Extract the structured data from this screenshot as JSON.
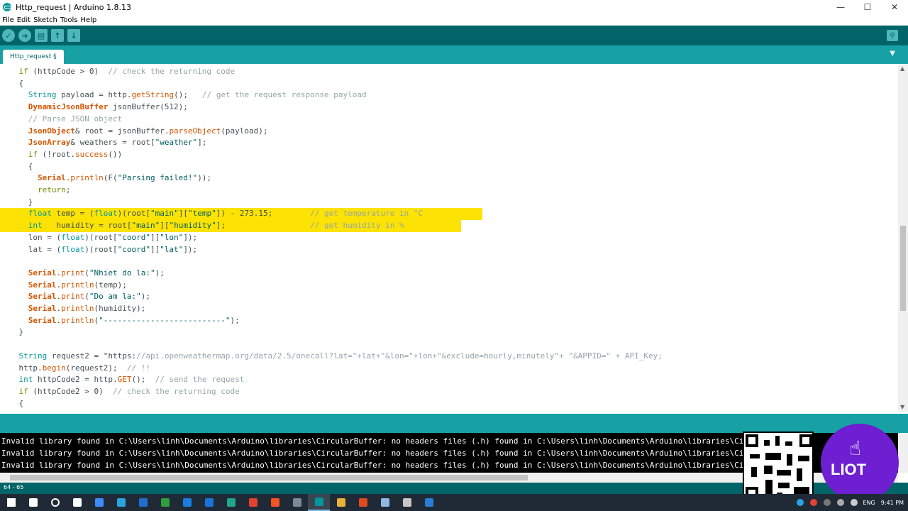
{
  "window": {
    "title": "Http_request | Arduino 1.8.13",
    "minimize": "—",
    "maximize": "☐",
    "close": "✕"
  },
  "menu": [
    "File",
    "Edit",
    "Sketch",
    "Tools",
    "Help"
  ],
  "toolbar": {
    "verify_icon": "check-icon",
    "upload_icon": "arrow-right-icon",
    "new_icon": "file-icon",
    "open_icon": "arrow-up-icon",
    "save_icon": "arrow-down-icon",
    "serial_icon": "magnifier-icon"
  },
  "tab": {
    "label": "Http_request §",
    "menu_icon": "▼"
  },
  "code_lines": [
    "    if (httpCode > 0)  // check the returning code",
    "    {",
    "      String payload = http.getString();   // get the request response payload",
    "      DynamicJsonBuffer jsonBuffer(512);",
    "      // Parse JSON object",
    "      JsonObject& root = jsonBuffer.parseObject(payload);",
    "      JsonArray& weathers = root[\"weather\"];",
    "      if (!root.success())",
    "      {",
    "        Serial.println(F(\"Parsing failed!\"));",
    "        return;",
    "      }",
    "      float temp = (float)(root[\"main\"][\"temp\"]) - 273.15;        // get temperature in °C",
    "      int   humidity = root[\"main\"][\"humidity\"];                  // get humidity in %",
    "      lon = (float)(root[\"coord\"][\"lon\"]);",
    "      lat = (float)(root[\"coord\"][\"lat\"]);",
    "",
    "      Serial.print(\"Nhiet do la:\");",
    "      Serial.println(temp);",
    "      Serial.print(\"Do am la:\");",
    "      Serial.println(humidity);",
    "      Serial.println(\"--------------------------\");",
    "    }",
    "",
    "    String request2 = \"https://api.openweathermap.org/data/2.5/onecall?lat=\"+lat+\"&lon=\"+lon+\"&exclude=hourly,minutely\"+ \"&APPID=\" + API_Key;",
    "    http.begin(request2);  // !!",
    "    int httpCode2 = http.GET();  // send the request",
    "    if (httpCode2 > 0)  // check the returning code",
    "    {"
  ],
  "console_lines": [
    "Invalid library found in C:\\Users\\linh\\Documents\\Arduino\\libraries\\CircularBuffer: no headers files (.h) found in C:\\Users\\linh\\Documents\\Arduino\\libraries\\CircularBuffer",
    "Invalid library found in C:\\Users\\linh\\Documents\\Arduino\\libraries\\CircularBuffer: no headers files (.h) found in C:\\Users\\linh\\Documents\\Arduino\\libraries\\CircularBuffer",
    "Invalid library found in C:\\Users\\linh\\Documents\\Arduino\\libraries\\CircularBuffer: no headers files (.h) found in C:\\Users\\linh\\Documents\\Arduino\\libraries\\CircularBuffer"
  ],
  "line_status": "64 - 65",
  "overlay": {
    "brand": "LIOT"
  },
  "taskbar": {
    "lang": "ENG",
    "time": "9:41 PM",
    "icons": [
      "windows-start-icon",
      "search-icon",
      "cortana-icon",
      "task-view-icon",
      "file-icon",
      "telegram-icon",
      "calculator-icon",
      "apps-icon",
      "edge-icon",
      "mail-icon",
      "chat-icon",
      "chrome-icon",
      "brave-icon",
      "photos-icon",
      "arduino-icon",
      "folder-icon",
      "app-red-icon",
      "notepad-icon",
      "settings-icon",
      "vscode-icon"
    ]
  },
  "colors": {
    "toolbar": "#006468",
    "tabbar": "#17a1a5",
    "highlight": "#fce304",
    "console_bg": "#000000"
  }
}
